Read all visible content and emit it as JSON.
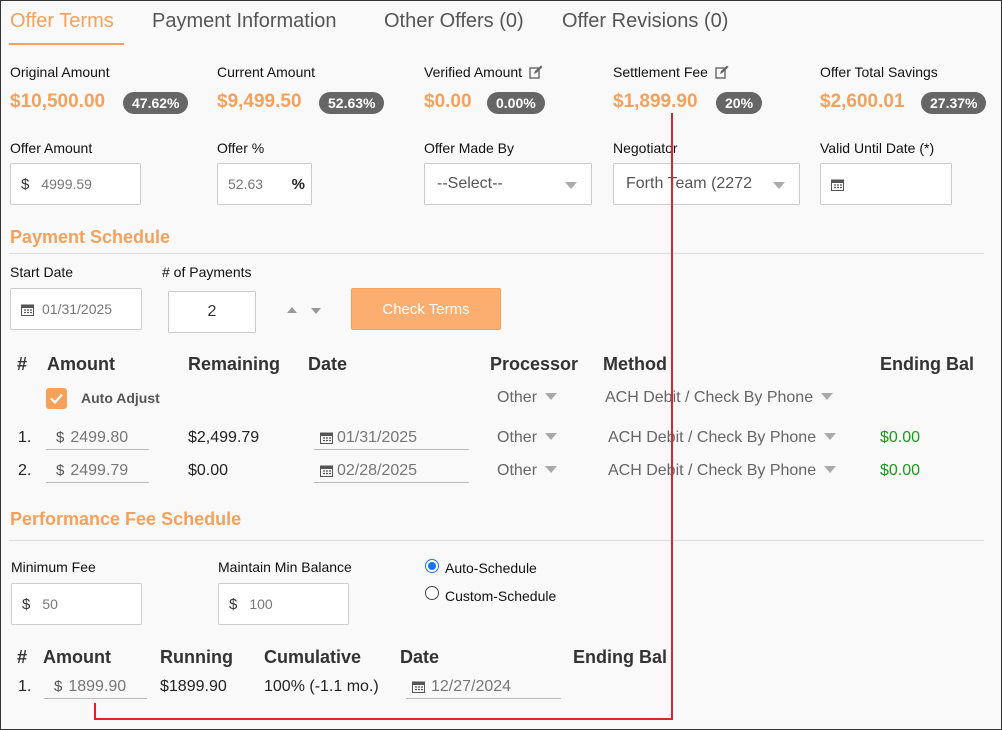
{
  "tabs": [
    {
      "label": "Offer Terms"
    },
    {
      "label": "Payment Information"
    },
    {
      "label": "Other Offers (0)"
    },
    {
      "label": "Offer Revisions (0)"
    }
  ],
  "summary": {
    "original": {
      "label": "Original Amount",
      "value": "$10,500.00",
      "badge": "47.62%"
    },
    "current": {
      "label": "Current Amount",
      "value": "$9,499.50",
      "badge": "52.63%"
    },
    "verified": {
      "label": "Verified Amount",
      "value": "$0.00",
      "badge": "0.00%"
    },
    "settlement": {
      "label": "Settlement Fee",
      "value": "$1,899.90",
      "badge": "20%"
    },
    "savings": {
      "label": "Offer Total Savings",
      "value": "$2,600.01",
      "badge": "27.37%"
    }
  },
  "offer": {
    "amount_label": "Offer Amount",
    "amount_prefix": "$",
    "amount_value": "4999.59",
    "percent_label": "Offer %",
    "percent_value": "52.63",
    "percent_suffix": "%",
    "made_by_label": "Offer Made By",
    "made_by_value": "--Select--",
    "negotiator_label": "Negotiator",
    "negotiator_value": "Forth Team (2272",
    "valid_until_label": "Valid Until Date (*)",
    "valid_until_value": ""
  },
  "payment_schedule": {
    "title": "Payment Schedule",
    "start_date_label": "Start Date",
    "start_date_value": "01/31/2025",
    "num_payments_label": "# of Payments",
    "num_payments_value": "2",
    "check_terms_label": "Check Terms",
    "headers": {
      "num": "#",
      "amount": "Amount",
      "remaining": "Remaining",
      "date": "Date",
      "processor": "Processor",
      "method": "Method",
      "ending": "Ending Bal"
    },
    "auto_adjust_label": "Auto Adjust",
    "default_processor": "Other",
    "default_method": "ACH Debit / Check By Phone",
    "rows": [
      {
        "num": "1.",
        "amount": "2499.80",
        "remaining": "$2,499.79",
        "date": "01/31/2025",
        "processor": "Other",
        "method": "ACH Debit / Check By Phone",
        "ending": "$0.00"
      },
      {
        "num": "2.",
        "amount": "2499.79",
        "remaining": "$0.00",
        "date": "02/28/2025",
        "processor": "Other",
        "method": "ACH Debit / Check By Phone",
        "ending": "$0.00"
      }
    ]
  },
  "performance": {
    "title": "Performance Fee Schedule",
    "min_fee_label": "Minimum Fee",
    "min_fee_value": "50",
    "min_balance_label": "Maintain Min Balance",
    "min_balance_value": "100",
    "auto_schedule_label": "Auto-Schedule",
    "custom_schedule_label": "Custom-Schedule",
    "headers": {
      "num": "#",
      "amount": "Amount",
      "running": "Running",
      "cumulative": "Cumulative",
      "date": "Date",
      "ending": "Ending Bal"
    },
    "rows": [
      {
        "num": "1.",
        "amount": "1899.90",
        "running": "$1899.90",
        "cumulative": "100% (-1.1 mo.)",
        "date": "12/27/2024"
      }
    ]
  },
  "currency_prefix": "$",
  "colors": {
    "accent": "#f6a15b",
    "badge": "#666666",
    "green": "#1a9a1a",
    "annotation": "#d9262b",
    "radio": "#1a73e8"
  }
}
